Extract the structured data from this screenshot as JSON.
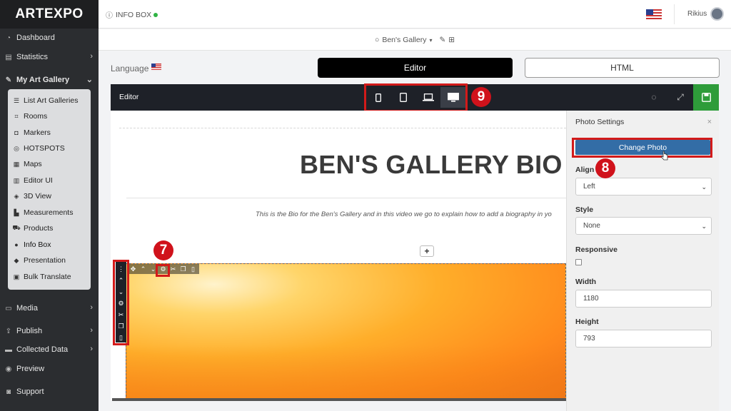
{
  "app": {
    "logo": "ARTEXPO"
  },
  "sidebar": {
    "items": [
      {
        "label": "Dashboard",
        "icon": "gauge-icon"
      },
      {
        "label": "Statistics",
        "icon": "chart-icon"
      },
      {
        "label": "My Art Gallery",
        "icon": "wrench-icon"
      },
      {
        "label": "Media",
        "icon": "monitor-icon"
      },
      {
        "label": "Publish",
        "icon": "upload-icon"
      },
      {
        "label": "Collected Data",
        "icon": "inbox-icon"
      },
      {
        "label": "Preview",
        "icon": "eye-icon"
      },
      {
        "label": "Support",
        "icon": "chat-icon"
      }
    ],
    "submenu": [
      {
        "label": "List Art Galleries",
        "icon": "list-icon"
      },
      {
        "label": "Rooms",
        "icon": "frame-icon"
      },
      {
        "label": "Markers",
        "icon": "marker-icon"
      },
      {
        "label": "HOTSPOTS",
        "icon": "target-icon"
      },
      {
        "label": "Maps",
        "icon": "map-icon"
      },
      {
        "label": "Editor UI",
        "icon": "layout-icon"
      },
      {
        "label": "3D View",
        "icon": "cube-icon"
      },
      {
        "label": "Measurements",
        "icon": "ruler-icon"
      },
      {
        "label": "Products",
        "icon": "cart-icon"
      },
      {
        "label": "Info Box",
        "icon": "info-icon"
      },
      {
        "label": "Presentation",
        "icon": "diamond-icon"
      },
      {
        "label": "Bulk Translate",
        "icon": "translate-icon"
      }
    ]
  },
  "topbar": {
    "title": "INFO BOX",
    "user": "Rikius"
  },
  "gallerybar": {
    "name": "Ben's Gallery"
  },
  "language": {
    "label": "Language"
  },
  "modes": {
    "editor": "Editor",
    "html": "HTML"
  },
  "editor": {
    "title": "Editor",
    "bio_title": "BEN'S GALLERY BIO",
    "bio_text": "This is the Bio for the Ben's Gallery and in this video we go to explain how to add a biography in yo",
    "add_label": "+"
  },
  "annotations": {
    "n7": "7",
    "n8": "8",
    "n9": "9",
    "color": "#d0121b"
  },
  "panel": {
    "title": "Photo Settings",
    "close": "×",
    "change_photo": "Change Photo",
    "align_label": "Align",
    "align_value": "Left",
    "style_label": "Style",
    "style_value": "None",
    "responsive_label": "Responsive",
    "width_label": "Width",
    "width_value": "1180",
    "height_label": "Height",
    "height_value": "793"
  },
  "colors": {
    "sidebar": "#2b2d30",
    "accent_blue": "#336da6",
    "save_green": "#2e9c3a",
    "toolbar": "#1e2128"
  }
}
